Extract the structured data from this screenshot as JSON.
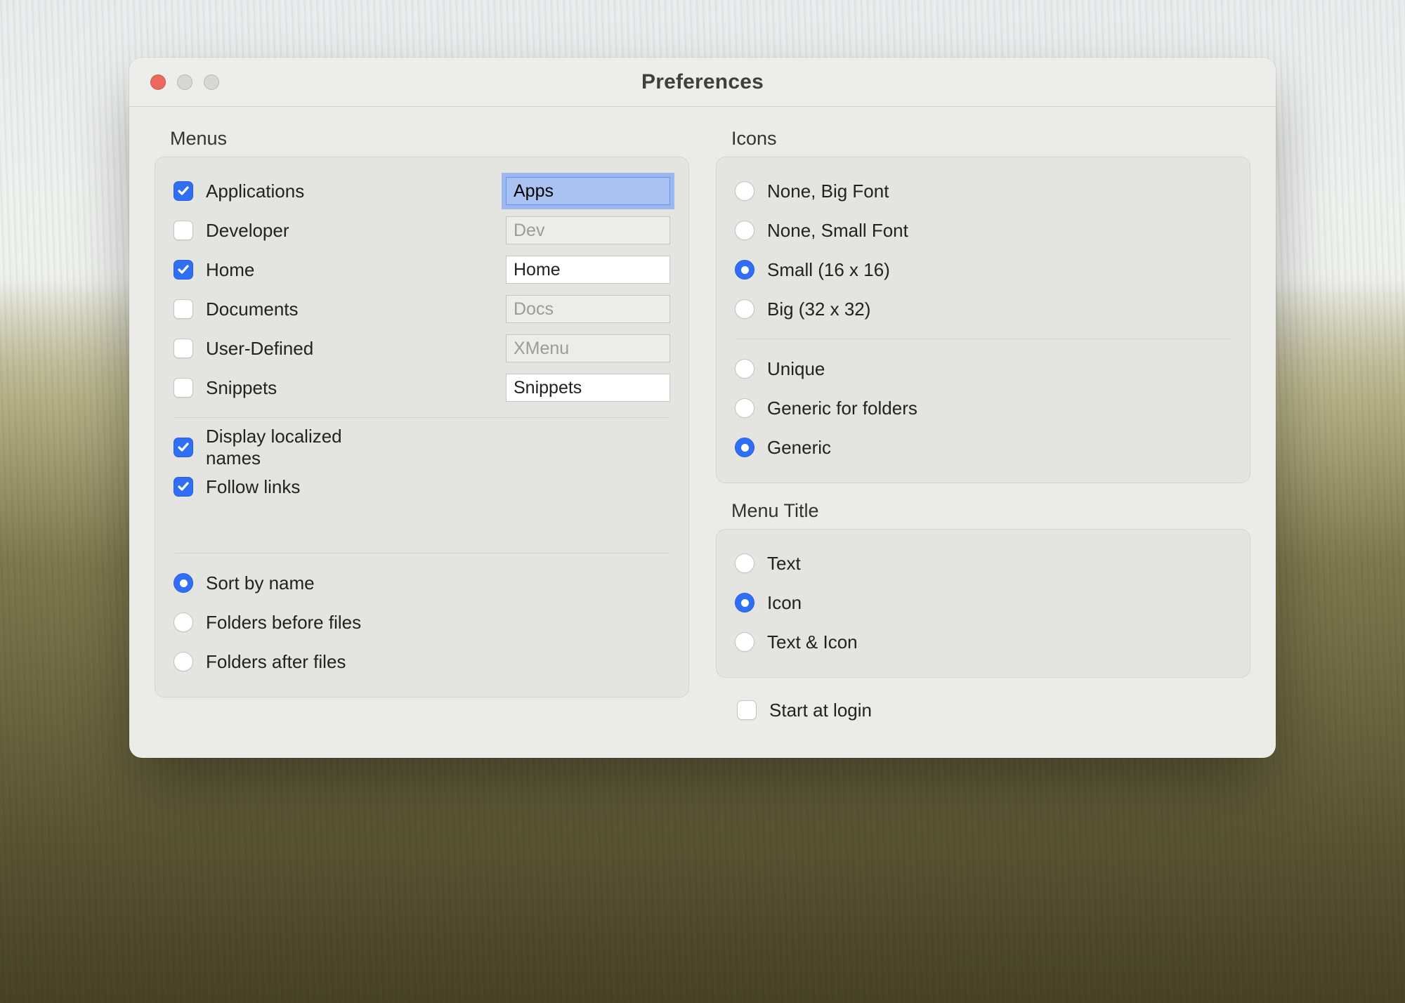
{
  "window": {
    "title": "Preferences"
  },
  "sections": {
    "menus_label": "Menus",
    "icons_label": "Icons",
    "menu_title_label": "Menu Title"
  },
  "menus": {
    "items": [
      {
        "label": "Applications",
        "checked": true,
        "value": "Apps",
        "enabled": true,
        "focused": true
      },
      {
        "label": "Developer",
        "checked": false,
        "value": "Dev",
        "enabled": false,
        "focused": false
      },
      {
        "label": "Home",
        "checked": true,
        "value": "Home",
        "enabled": true,
        "focused": false
      },
      {
        "label": "Documents",
        "checked": false,
        "value": "Docs",
        "enabled": false,
        "focused": false
      },
      {
        "label": "User-Defined",
        "checked": false,
        "value": "XMenu",
        "enabled": false,
        "focused": false
      },
      {
        "label": "Snippets",
        "checked": false,
        "value": "Snippets",
        "enabled": true,
        "focused": false
      }
    ],
    "display_localized": {
      "label": "Display localized names",
      "checked": true
    },
    "follow_links": {
      "label": "Follow links",
      "checked": true
    },
    "sort": {
      "options": [
        {
          "label": "Sort by name",
          "selected": true
        },
        {
          "label": "Folders before files",
          "selected": false
        },
        {
          "label": "Folders after files",
          "selected": false
        }
      ]
    }
  },
  "icons": {
    "size": {
      "options": [
        {
          "label": "None, Big Font",
          "selected": false
        },
        {
          "label": "None, Small Font",
          "selected": false
        },
        {
          "label": "Small (16 x 16)",
          "selected": true
        },
        {
          "label": "Big (32 x 32)",
          "selected": false
        }
      ]
    },
    "style": {
      "options": [
        {
          "label": "Unique",
          "selected": false
        },
        {
          "label": "Generic for folders",
          "selected": false
        },
        {
          "label": "Generic",
          "selected": true
        }
      ]
    }
  },
  "menu_title": {
    "options": [
      {
        "label": "Text",
        "selected": false
      },
      {
        "label": "Icon",
        "selected": true
      },
      {
        "label": "Text & Icon",
        "selected": false
      }
    ]
  },
  "start_at_login": {
    "label": "Start at login",
    "checked": false
  }
}
